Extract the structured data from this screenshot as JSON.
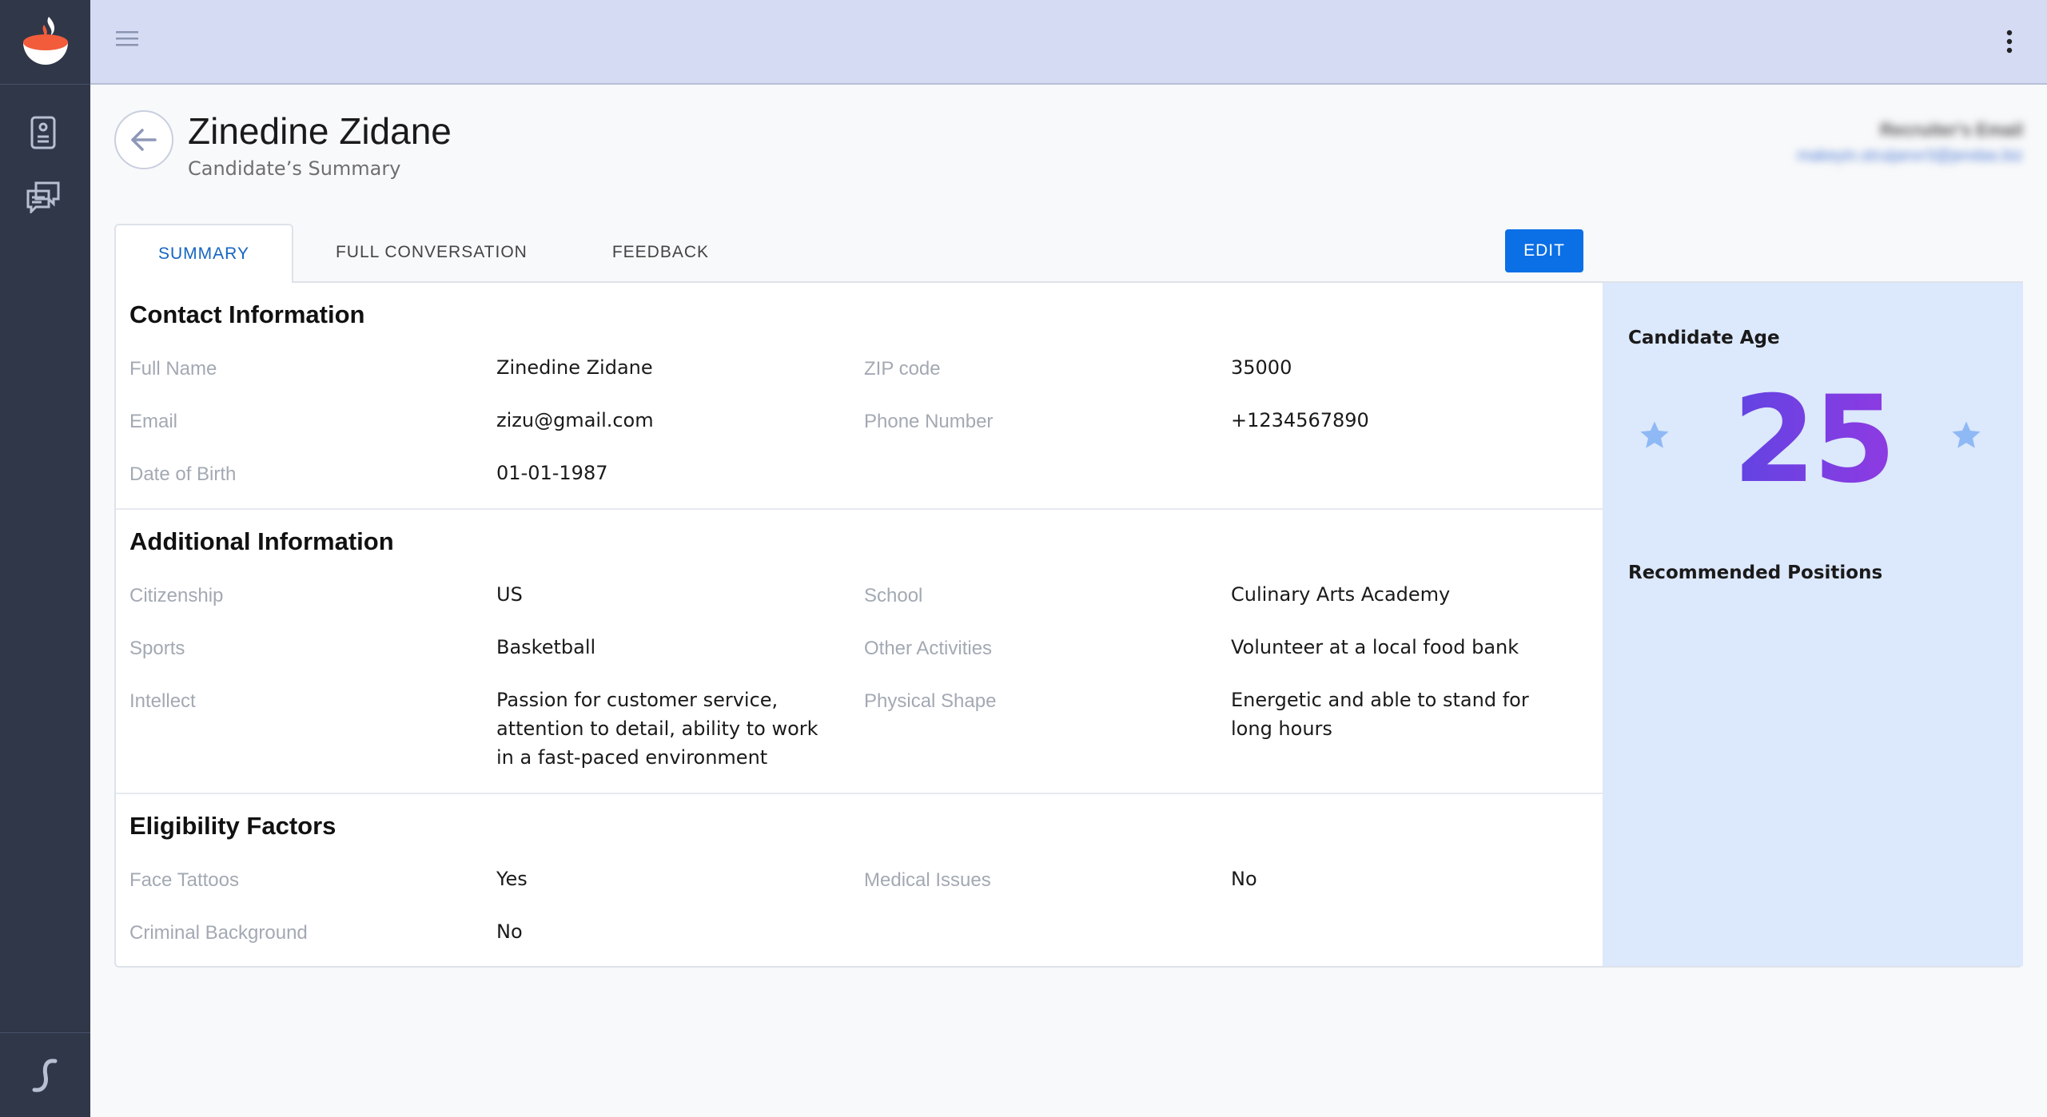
{
  "header": {
    "title": "Zinedine Zidane",
    "subtitle": "Candidate’s Summary",
    "recruiter_label": "Recruiter's Email",
    "recruiter_email": "makeyin.struijanvr3@jendas.biz"
  },
  "tabs": [
    {
      "label": "SUMMARY",
      "active": true
    },
    {
      "label": "FULL CONVERSATION",
      "active": false
    },
    {
      "label": "FEEDBACK",
      "active": false
    }
  ],
  "edit_label": "EDIT",
  "contact": {
    "title": "Contact Information",
    "fields": [
      {
        "label": "Full Name",
        "value": "Zinedine Zidane"
      },
      {
        "label": "ZIP code",
        "value": "35000"
      },
      {
        "label": "Email",
        "value": "zizu@gmail.com"
      },
      {
        "label": "Phone Number",
        "value": "+1234567890"
      },
      {
        "label": "Date of Birth",
        "value": "01-01-1987"
      }
    ]
  },
  "additional": {
    "title": "Additional Information",
    "fields": [
      {
        "label": "Citizenship",
        "value": "US"
      },
      {
        "label": "School",
        "value": "Culinary Arts Academy"
      },
      {
        "label": "Sports",
        "value": "Basketball"
      },
      {
        "label": "Other Activities",
        "value": "Volunteer at a local food bank"
      },
      {
        "label": "Intellect",
        "value": "Passion for customer service, attention to detail, ability to work in a fast-paced environment"
      },
      {
        "label": "Physical Shape",
        "value": "Energetic and able to stand for long hours"
      }
    ]
  },
  "eligibility": {
    "title": "Eligibility Factors",
    "fields": [
      {
        "label": "Face Tattoos",
        "value": "Yes"
      },
      {
        "label": "Medical Issues",
        "value": "No"
      },
      {
        "label": "Criminal Background",
        "value": "No"
      }
    ]
  },
  "side": {
    "age_title": "Candidate Age",
    "age_value": "25",
    "positions_title": "Recommended Positions"
  },
  "colors": {
    "sidebar": "#2f3748",
    "topbar": "#d5dbf3",
    "accent": "#0b6fe6",
    "side_panel": "#dce8fc"
  },
  "icons": {
    "logo": "bowl-flame-logo",
    "nav": [
      "clipboard-icon",
      "chat-icon"
    ],
    "bottom": "s-logo"
  }
}
